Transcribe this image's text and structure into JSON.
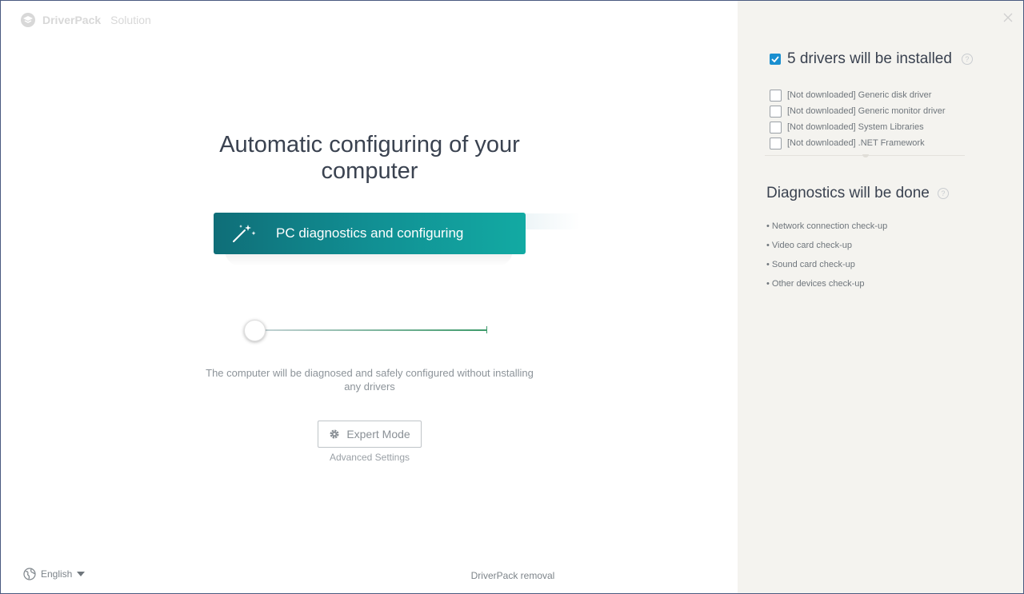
{
  "app": {
    "brand": "DriverPack",
    "brand_sub": "Solution"
  },
  "main": {
    "title": "Automatic configuring of your computer",
    "cta_label": "PC diagnostics and configuring",
    "description": "The computer will be diagnosed and safely configured without installing any drivers",
    "expert_label": "Expert Mode",
    "advanced_label": "Advanced Settings"
  },
  "footer": {
    "language": "English",
    "removal": "DriverPack removal"
  },
  "sidebar": {
    "drivers_heading": "5 drivers will be installed",
    "drivers_checked": true,
    "drivers": [
      {
        "label": "[Not downloaded] Generic disk driver",
        "checked": false
      },
      {
        "label": "[Not downloaded] Generic monitor driver",
        "checked": false
      },
      {
        "label": "[Not downloaded] System Libraries",
        "checked": false
      },
      {
        "label": "[Not downloaded] .NET Framework",
        "checked": false
      }
    ],
    "diagnostics_heading": "Diagnostics will be done",
    "diagnostics": [
      "• Network connection check-up",
      "• Video card check-up",
      "• Sound card check-up",
      "• Other devices check-up"
    ]
  },
  "colors": {
    "accent_blue": "#1a8fd0",
    "cta_start": "#0f6e78",
    "cta_end": "#12aaa3",
    "sidebar_bg": "#f4f3ef"
  }
}
